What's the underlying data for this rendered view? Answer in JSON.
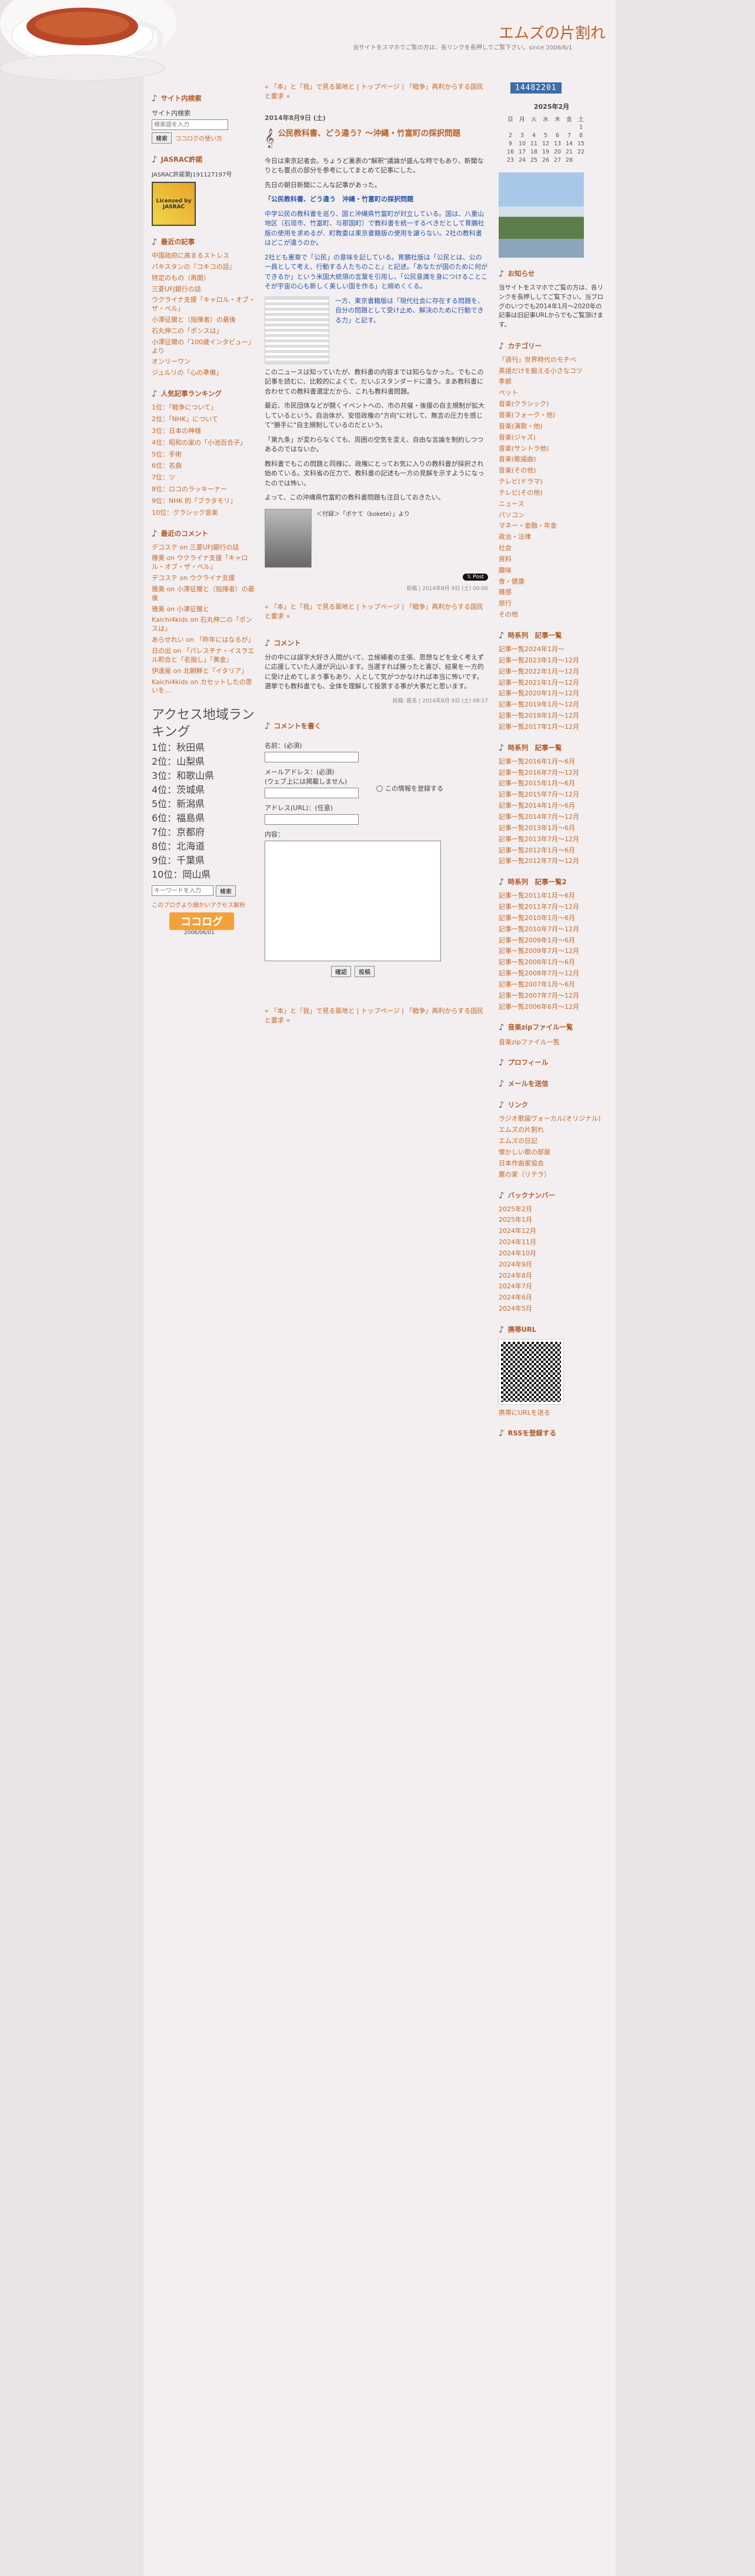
{
  "blog": {
    "title": "エムズの片割れ",
    "subtitle": "当サイトをスマホでご覧の方は、各リンクを長押しでご覧下さい。since 2006/6/1"
  },
  "nav_top": "« 「本」と「我」で見る築地と | トップページ | 「戦争」再利からする国民と要求 »",
  "entry": {
    "date": "2014年8月9日 (土)",
    "title": "公民教科書、どう違う？〜沖縄・竹富町の採択問題",
    "paras": [
      "今日は東京記者会。ちょうど裏表の\"解釈\"議論が盛んな時でもあり、新聞なりとも要点の部分を参考にしてまとめて記事にした。",
      "先日の朝日新聞にこんな記事があった。"
    ],
    "heading": "「公民教科書、どう違う　沖縄・竹富町の採択問題",
    "blue_paras": [
      "中学公民の教科書を巡り、国と沖縄県竹富町が対立している。国は、八重山地区（石垣市、竹富町、与那国町）で教科書を統一するべきだとして育鵬社版の使用を求めるが、町教委は東京書籍版の使用を譲らない。2社の教科書はどこが違うのか。",
      "2社とも憲章で「公民」の意味を記している。育鵬社版は「公民とは、公の一員として考え、行動する人たちのこと」と記述。「あなたが国のために何ができるか」という米国大統領の言葉を引用し、「公民意識を身につけることこそが宇宙の心も新しく美しい国を作る」と締めくくる。",
      "一方、東京書籍版は「現代社会に存在する問題を、自分の問題として受け止め、解決のために行動できる力」と記す。"
    ],
    "paras2": [
      "この二ュースは知っていたが、教科書の内容までは知らなかった。でもこの記事を読むに、比較的によくて、だいぶスタンダードに違う。まあ教科書に合わせての教科書選定だから、これも教科書問題。",
      "最近、市民団体などが開くイベントへの、市の共催・後援の自主規制が拡大しているという。自治体が、安倍政権の\"方向\"に対して、無言の圧力を感じて\"勝手に\"自主規制しているのだという。",
      "「第九条」が変わらなくても、周囲の空気を変え、自由な言論を制約しつつあるのではないか。",
      "教科書でもこの問題と同様に、政権にとってお気に入りの教科書が採択され始めている。文科省の圧力で、教科書の記述も一方の見解を示すようになったのでは怖い。",
      "よって、この沖縄県竹富町の教科書問題も注目しておきたい。"
    ],
    "footnote": "＜付録＞「ボケて（bokete）」より",
    "meta": "投稿 | 2014年8月 9日 (土) 00:00"
  },
  "comment_section": {
    "title": "コメント",
    "text": "分の中には誤字大好き人間がいて、立候補者の主張、思想などを全く考えずに応援していた人達が沢山います。当選すれば勝ったと喜び、結果を一方的に受け止めてしまう事もあり、人として気がつかなければ本当に怖いです。選挙でも教科書でも、全体を理解して投票する事が大事だと思います。",
    "meta": "投稿: 匿名 | 2014年8月 9日 (土) 08:17"
  },
  "form": {
    "title": "コメントを書く",
    "name": "名前：(必須)",
    "email": "メールアドレス：(必須)\n(ウェブ上には掲載しません)",
    "url": "アドレス(URL)：(任意)",
    "remember": "この情報を登録する",
    "content": "内容：",
    "btn_check": "確認",
    "btn_post": "投稿"
  },
  "left": {
    "search_title": "サイト内検索",
    "search_label": "サイト内検索",
    "search_placeholder": "検索語を入力",
    "search_btn": "検索",
    "search_link": "ココログの使い方",
    "jasrac": "JASRAC許諾",
    "jasrac_no": "JASRAC許諾第J191127197号",
    "badge": "Licensed by JASRAC",
    "recent_title": "最近の記事",
    "recent": [
      "中国政府に高まるストレス",
      "パキスタンの『コキコの話』",
      "特定のもの（再開）",
      "三菱UFJ銀行の話",
      "ウクライナ支援「キャロル・オブ・ザ・ベル」",
      "小澤征爾と（指揮者）の最後",
      "石丸伸二の「ポンスは」",
      "小澤征爾の「100歳インタビュー」より",
      "オンリーワン",
      "ジュルリの「心の準備」"
    ],
    "rank_title": "人気記事ランキング",
    "rank": [
      "1位：「戦争について」",
      "2位：「NHK」について",
      "3位：日本の神様",
      "4位：昭和の家の「小池百合子」",
      "5位：手術",
      "6位：名曲",
      "7位：ツ",
      "8位：ロコのラッキーナー",
      "9位：NHK 的「ブラタモリ」",
      "10位：クラシック音楽"
    ],
    "cmt_title": "最近のコメント",
    "cmts": [
      "デコステ on 三菱UFJ銀行の話",
      "雅美 on ウクライナ支援「キャロル・オブ・ザ・ベル」",
      "デコステ on ウクライナ支援",
      "雅美 on 小澤征爾と（指揮者）の最後",
      "雅美 on 小澤征爾と",
      "Kaichi4kids on 石丸伸二の「ポンスは」",
      "あらせれい on 「昨年にはなるが」",
      "日の出 on 「パレスチナ・イスラエル和合と「名指し」「黄金」",
      "伊達屋 on 北朝鮮と「イタリア」",
      "Kaichi4kids on カセットしたの思いを…"
    ],
    "access_title": "アクセス地域ランキング",
    "access": [
      "1位：秋田県",
      "2位：山梨県",
      "3位：和歌山県",
      "4位：茨城県",
      "5位：新潟県",
      "6位：福島県",
      "7位：京都府",
      "8位：北海道",
      "9位：千葉県",
      "10位：岡山県"
    ],
    "search2_placeholder": "キーワードを入力",
    "search2_btn": "検索",
    "blog_link": "このブログより細かいアクセス解析",
    "cocolog": "ココログ",
    "since": "2006/06/01"
  },
  "right": {
    "counter": "14482201",
    "cal_title": "2025年2月",
    "cal_head": [
      "日",
      "月",
      "火",
      "水",
      "木",
      "金",
      "土"
    ],
    "cal_rows": [
      [
        "",
        "",
        "",
        "",
        "",
        "",
        "1"
      ],
      [
        "2",
        "3",
        "4",
        "5",
        "6",
        "7",
        "8"
      ],
      [
        "9",
        "10",
        "11",
        "12",
        "13",
        "14",
        "15"
      ],
      [
        "16",
        "17",
        "18",
        "19",
        "20",
        "21",
        "22"
      ],
      [
        "23",
        "24",
        "25",
        "26",
        "27",
        "28",
        ""
      ]
    ],
    "info_title": "お知らせ",
    "info_text": "当サイトをスマホでご覧の方は、各リンクを長押ししてご覧下さい。当ブログのいつでも2014年1月〜2020年の記事は旧記事URLからでもご覧頂けます。",
    "cat_title": "カテゴリー",
    "cats": [
      "「週刊」世界時代のモチベ",
      "英語だけを鍛える小さなコツ",
      "季節",
      "ペット",
      "音楽(クラシック)",
      "音楽(フォーク・他)",
      "音楽(演歌・他)",
      "音楽(ジャズ)",
      "音楽(サントラ他)",
      "音楽(歌謡曲)",
      "音楽(その他)",
      "テレビ(ドラマ)",
      "テレビ(その他)",
      "ニュース",
      "パソコン",
      "マネー・金融・年金",
      "政治・法律",
      "社会",
      "資料",
      "趣味",
      "食・健康",
      "雑感",
      "旅行",
      "その他"
    ],
    "h1_title": "時系列　記事一覧",
    "h1": [
      "記事一覧2024年1月〜",
      "記事一覧2023年1月〜12月",
      "記事一覧2022年1月〜12月",
      "記事一覧2021年1月〜12月",
      "記事一覧2020年1月〜12月",
      "記事一覧2019年1月〜12月",
      "記事一覧2018年1月〜12月",
      "記事一覧2017年1月〜12月"
    ],
    "h2_title": "時系列　記事一覧",
    "h2": [
      "記事一覧2016年1月〜6月",
      "記事一覧2016年7月〜12月",
      "記事一覧2015年1月〜6月",
      "記事一覧2015年7月〜12月",
      "記事一覧2014年1月〜6月",
      "記事一覧2014年7月〜12月",
      "記事一覧2013年1月〜6月",
      "記事一覧2013年7月〜12月",
      "記事一覧2012年1月〜6月",
      "記事一覧2012年7月〜12月"
    ],
    "h3_title": "時系列　記事一覧2",
    "h3": [
      "記事一覧2011年1月〜6月",
      "記事一覧2011年7月〜12月",
      "記事一覧2010年1月〜6月",
      "記事一覧2010年7月〜12月",
      "記事一覧2009年1月〜6月",
      "記事一覧2009年7月〜12月",
      "記事一覧2008年1月〜6月",
      "記事一覧2008年7月〜12月",
      "記事一覧2007年1月〜6月",
      "記事一覧2007年7月〜12月",
      "記事一覧2006年6月〜12月"
    ],
    "zip_title": "音楽zipファイル一覧",
    "zip_link": "音楽zipファイル一覧",
    "profile": "プロフィール",
    "mail": "メールを送信",
    "link_title": "リンク",
    "links": [
      "ラジオ歌謡ヴォーカル(オリジナル)",
      "エムズの片割れ",
      "エムズの日記",
      "懐かしい歌の部屋",
      "日本作曲家協会",
      "鷹の家（リテラ）"
    ],
    "bn_title": "バックナンバー",
    "bn": [
      "2025年2月",
      "2025年1月",
      "2024年12月",
      "2024年11月",
      "2024年10月",
      "2024年9月",
      "2024年8月",
      "2024年7月",
      "2024年6月",
      "2024年5月"
    ],
    "qr_title": "携帯URL",
    "qr_link": "携帯にURLを送る",
    "rss": "RSSを登録する"
  }
}
